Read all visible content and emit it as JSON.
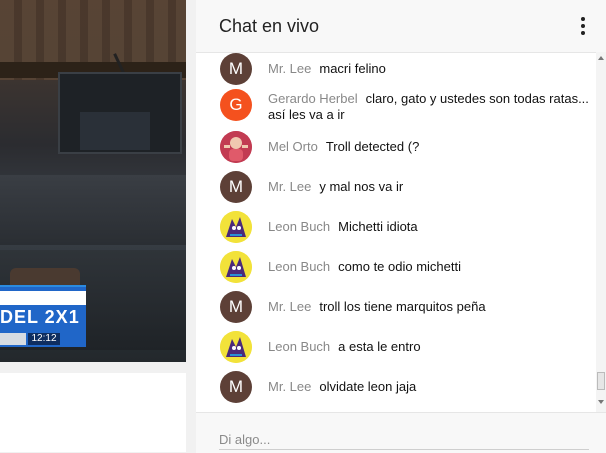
{
  "video": {
    "overlay_tag": "DEL 2X1",
    "overlay_clock": "12:12"
  },
  "chat": {
    "title": "Chat en vivo",
    "input_placeholder": "Di algo...",
    "messages": [
      {
        "author": "Mr. Lee",
        "text": "macri felino",
        "avatar": "M"
      },
      {
        "author": "Gerardo Herbel",
        "text": "claro, gato y ustedes son todas ratas... así les va a ir",
        "avatar": "G"
      },
      {
        "author": "Mel Orto",
        "text": "Troll detected (?",
        "avatar": ""
      },
      {
        "author": "Mr. Lee",
        "text": "y mal nos va ir",
        "avatar": "M"
      },
      {
        "author": "Leon Buch",
        "text": "Michetti idiota",
        "avatar": ""
      },
      {
        "author": "Leon Buch",
        "text": "como te odio michetti",
        "avatar": ""
      },
      {
        "author": "Mr. Lee",
        "text": "troll los tiene marquitos peña",
        "avatar": "M"
      },
      {
        "author": "Leon Buch",
        "text": "a esta le entro",
        "avatar": ""
      },
      {
        "author": "Mr. Lee",
        "text": "olvidate leon jaja",
        "avatar": "M"
      }
    ]
  },
  "colors": {
    "avatar_mrlee": "#5d4037",
    "avatar_gerardo": "#f4511e",
    "avatar_mel": "#c23b52",
    "avatar_leon": "#f2e23a",
    "author_text": "#888888"
  }
}
